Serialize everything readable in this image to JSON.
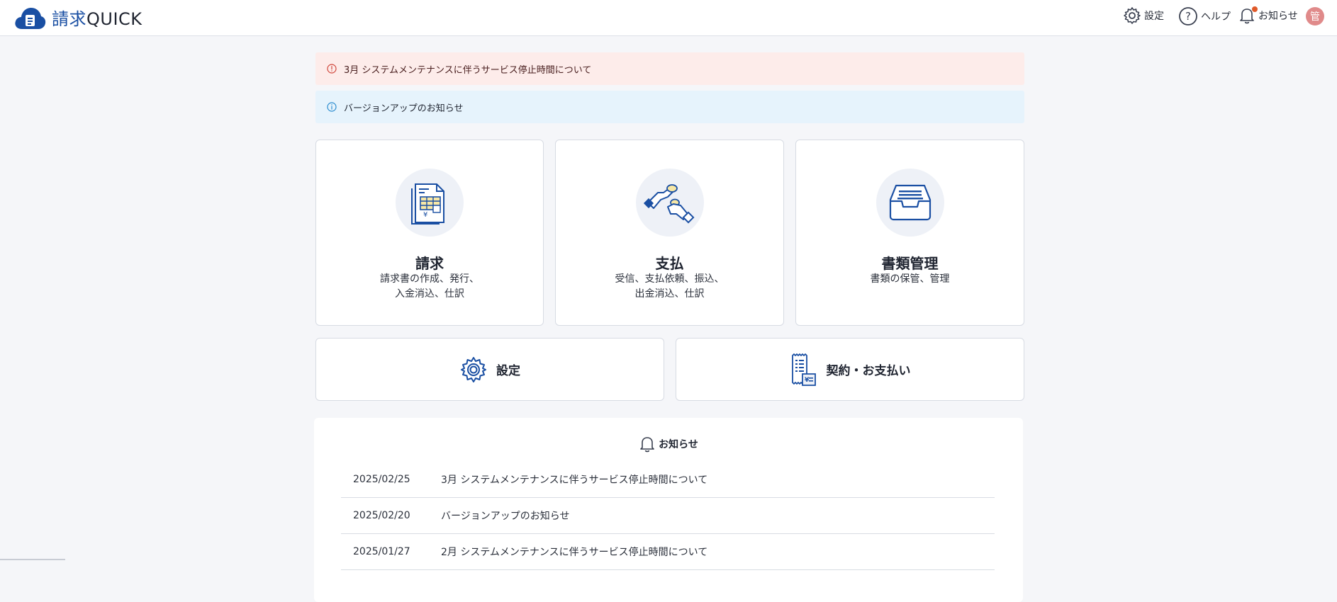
{
  "header": {
    "logo_text_ja": "請求",
    "logo_text_en": "QUICK",
    "settings_label": "設定",
    "help_label": "ヘルプ",
    "notice_label": "お知らせ",
    "avatar_initial": "管"
  },
  "alerts": [
    {
      "type": "error",
      "text": "3月 システムメンテナンスに伴うサービス停止時間について"
    },
    {
      "type": "info",
      "text": "バージョンアップのお知らせ"
    }
  ],
  "cards": [
    {
      "title": "請求",
      "desc_line1": "請求書の作成、発行、",
      "desc_line2": "入金消込、仕訳",
      "icon": "invoice-icon"
    },
    {
      "title": "支払",
      "desc_line1": "受信、支払依頼、振込、",
      "desc_line2": "出金消込、仕訳",
      "icon": "payment-hand-icon"
    },
    {
      "title": "書類管理",
      "desc_line1": "書類の保管、管理",
      "desc_line2": "",
      "icon": "document-tray-icon"
    }
  ],
  "wide_buttons": [
    {
      "label": "設定",
      "icon": "gear-icon"
    },
    {
      "label": "契約・お支払い",
      "icon": "receipt-icon"
    }
  ],
  "news": {
    "title": "お知らせ",
    "items": [
      {
        "date": "2025/02/25",
        "text": "3月 システムメンテナンスに伴うサービス停止時間について"
      },
      {
        "date": "2025/02/20",
        "text": "バージョンアップのお知らせ"
      },
      {
        "date": "2025/01/27",
        "text": "2月 システムメンテナンスに伴うサービス停止時間について"
      }
    ]
  },
  "colors": {
    "brand": "#1a4fa3",
    "error_bg": "#fdecea",
    "info_bg": "#e6f3fc",
    "notify_dot": "#e05a2a"
  }
}
